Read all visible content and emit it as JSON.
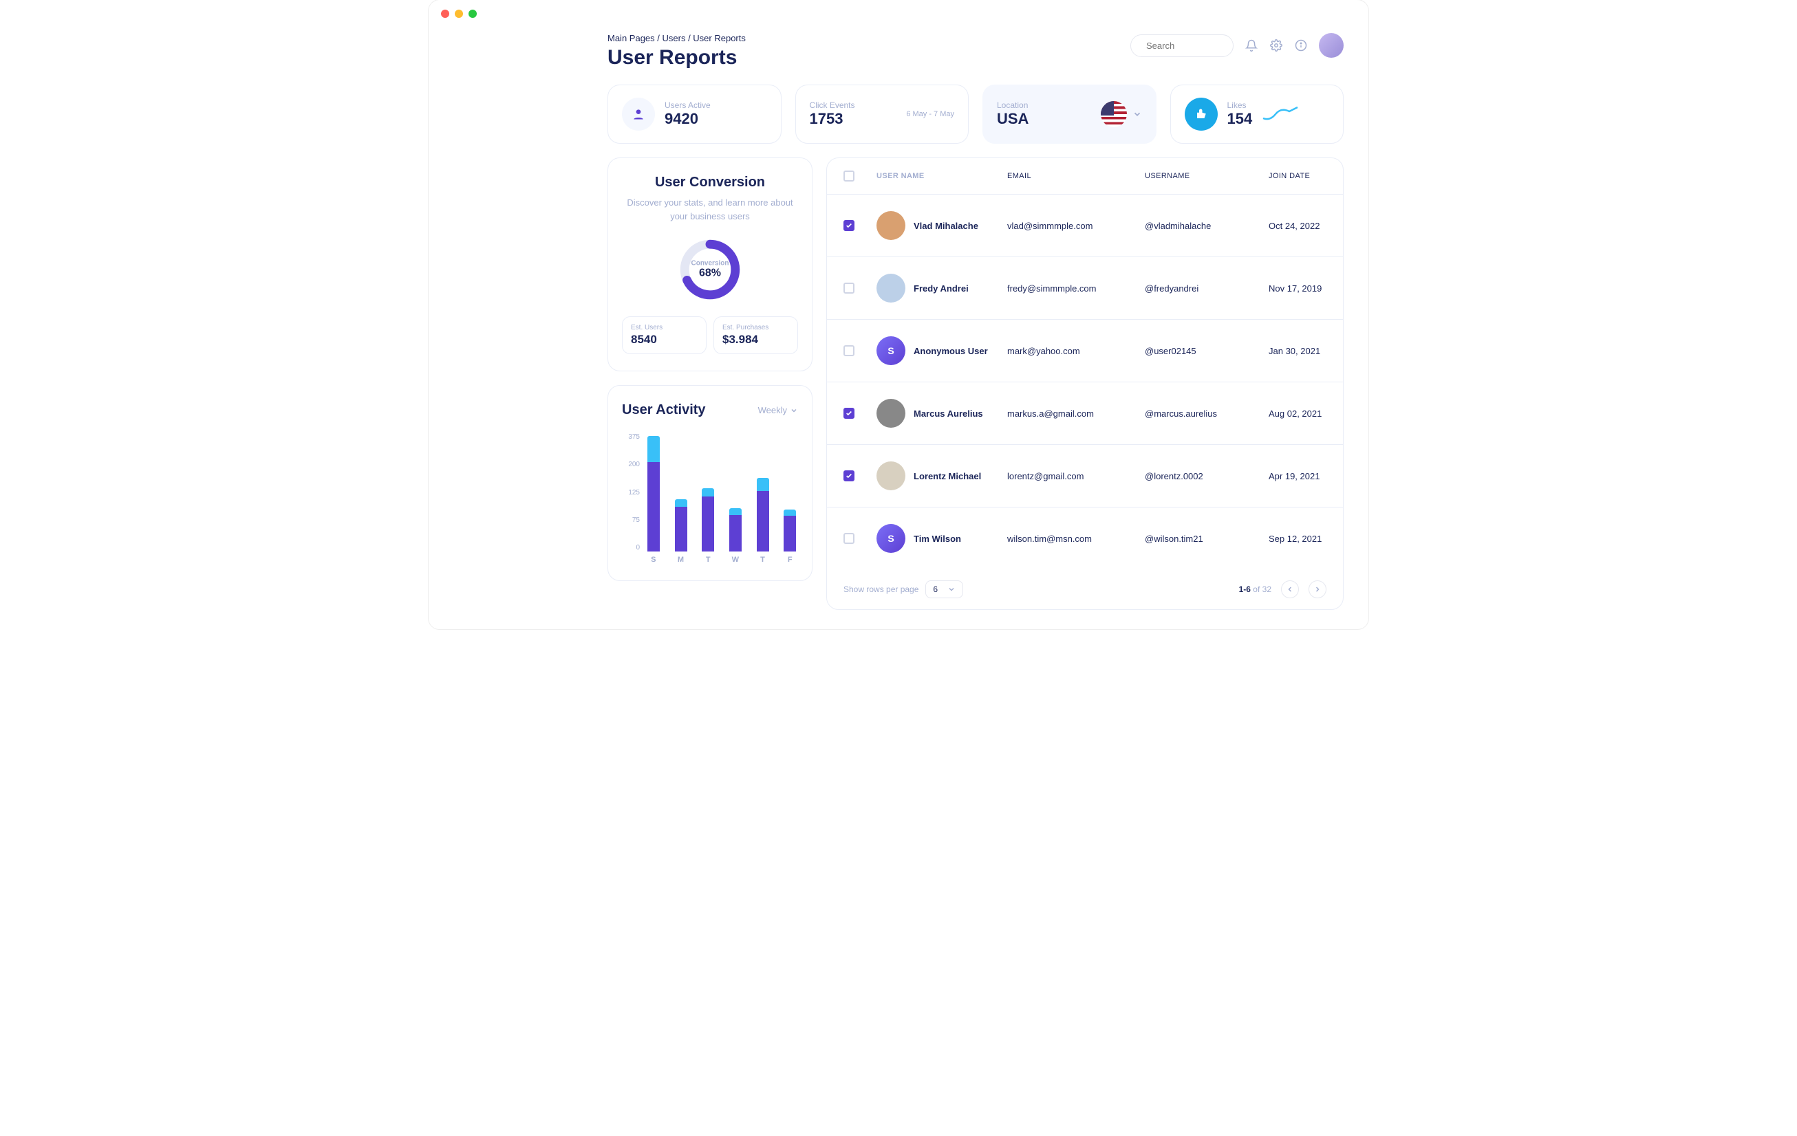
{
  "breadcrumb": {
    "a": "Main Pages",
    "b": "Users",
    "c": "User Reports"
  },
  "page_title": "User Reports",
  "search": {
    "placeholder": "Search"
  },
  "stats": {
    "users_active": {
      "label": "Users Active",
      "value": "9420"
    },
    "click_events": {
      "label": "Click Events",
      "value": "1753",
      "range": "6 May - 7 May"
    },
    "location": {
      "label": "Location",
      "value": "USA"
    },
    "likes": {
      "label": "Likes",
      "value": "154"
    }
  },
  "conversion": {
    "title": "User Conversion",
    "subtitle": "Discover your stats, and learn more about your business users",
    "donut_label": "Conversion",
    "donut_value_text": "68%",
    "donut_value": 68,
    "est_users_label": "Est. Users",
    "est_users_value": "8540",
    "est_purch_label": "Est. Purchases",
    "est_purch_value": "$3.984"
  },
  "activity": {
    "title": "User Activity",
    "period": "Weekly"
  },
  "chart_data": {
    "type": "bar",
    "title": "User Activity",
    "xlabel": "",
    "ylabel": "",
    "ylim": [
      0,
      450
    ],
    "y_ticks": [
      375,
      200,
      125,
      75,
      0
    ],
    "categories": [
      "S",
      "M",
      "T",
      "W",
      "T",
      "F"
    ],
    "series": [
      {
        "name": "primary",
        "color": "#5d3fd3",
        "values": [
          340,
          170,
          210,
          140,
          230,
          135
        ]
      },
      {
        "name": "secondary",
        "color": "#39c0f8",
        "values": [
          100,
          30,
          30,
          25,
          50,
          25
        ]
      }
    ]
  },
  "table": {
    "headers": {
      "name": "USER NAME",
      "email": "EMAIL",
      "username": "USERNAME",
      "date": "JOIN DATE"
    },
    "rows": [
      {
        "checked": true,
        "name": "Vlad Mihalache",
        "email": "vlad@simmmple.com",
        "username": "@vladmihalache",
        "date": "Oct 24, 2022",
        "avatar_bg": "#d9a070"
      },
      {
        "checked": false,
        "name": "Fredy Andrei",
        "email": "fredy@simmmple.com",
        "username": "@fredyandrei",
        "date": "Nov 17, 2019",
        "avatar_bg": "#bcd0e8"
      },
      {
        "checked": false,
        "name": "Anonymous User",
        "email": "mark@yahoo.com",
        "username": "@user02145",
        "date": "Jan 30, 2021",
        "avatar_bg": "grad"
      },
      {
        "checked": true,
        "name": "Marcus Aurelius",
        "email": "markus.a@gmail.com",
        "username": "@marcus.aurelius",
        "date": "Aug 02, 2021",
        "avatar_bg": "#888"
      },
      {
        "checked": true,
        "name": "Lorentz Michael",
        "email": "lorentz@gmail.com",
        "username": "@lorentz.0002",
        "date": "Apr 19, 2021",
        "avatar_bg": "#d8d0c0"
      },
      {
        "checked": false,
        "name": "Tim Wilson",
        "email": "wilson.tim@msn.com",
        "username": "@wilson.tim21",
        "date": "Sep 12, 2021",
        "avatar_bg": "grad"
      }
    ]
  },
  "pagination": {
    "rows_label": "Show rows per page",
    "rows_value": "6",
    "range": "1-6",
    "of_word": "of",
    "total": "32"
  }
}
